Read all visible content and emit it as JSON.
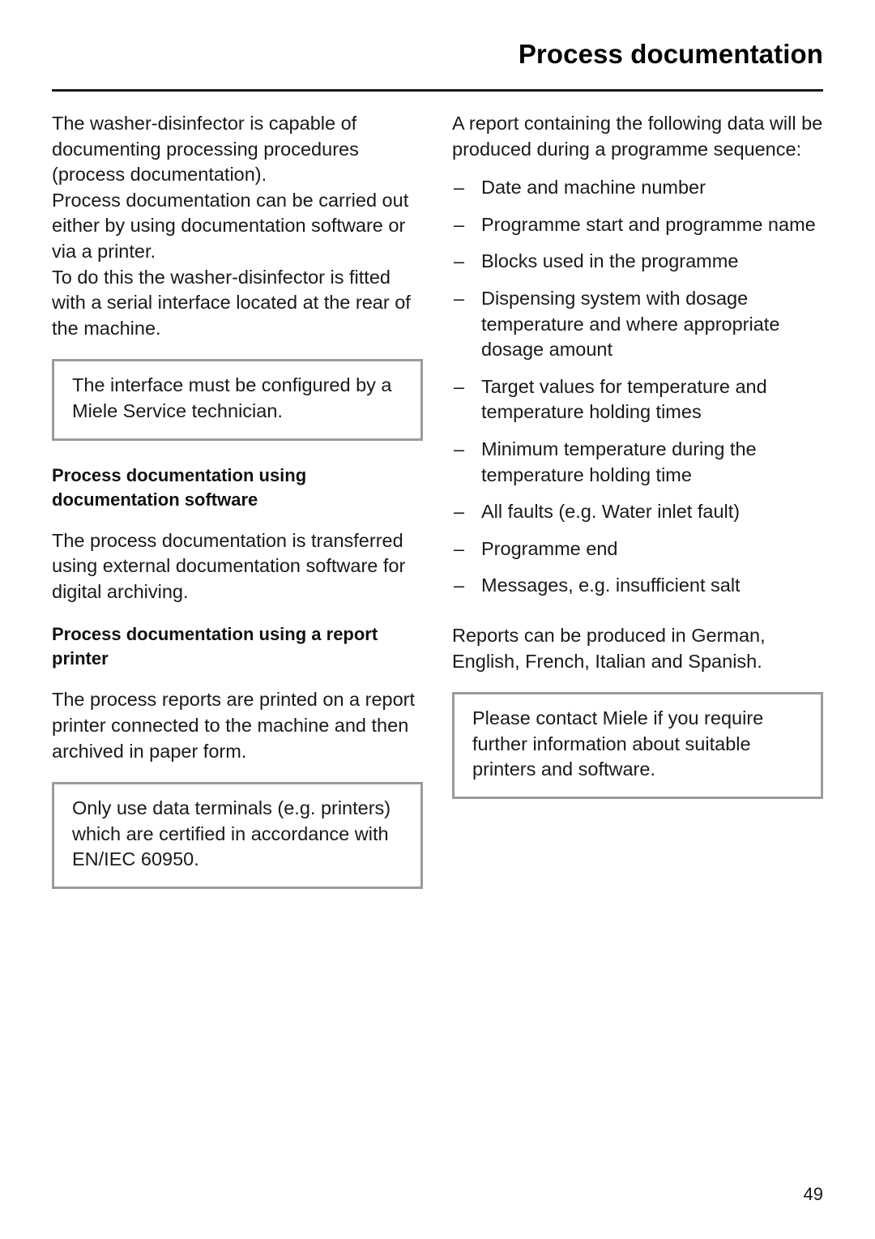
{
  "header": {
    "title": "Process documentation"
  },
  "left_column": {
    "intro_paragraphs": [
      "The washer-disinfector is capable of documenting processing procedures (process documentation).",
      "Process documentation can be carried out either by using documentation software or via a printer.",
      "To do this the washer-disinfector is fitted with a serial interface located at the rear of the machine."
    ],
    "note_1": "The interface must be configured by a Miele Service technician.",
    "subhead_1": "Process documentation using documentation software",
    "para_software": "The process documentation is transferred using external documentation software for digital archiving.",
    "subhead_2": "Process documentation using a report printer",
    "para_printer": "The process reports are printed on a report printer connected to the machine and then archived in paper form.",
    "note_2": "Only use data terminals (e.g. printers) which are certified in accordance with EN/IEC 60950."
  },
  "right_column": {
    "intro": "A report containing the following data will be produced during a programme sequence:",
    "dash": "–",
    "items": [
      "Date and machine number",
      "Programme start and programme name",
      "Blocks used in the programme",
      "Dispensing system with dosage temperature and where appropriate dosage amount",
      "Target values for temperature and temperature holding times",
      "Minimum temperature during the temperature holding time",
      "All faults (e.g. Water inlet fault)",
      "Programme end",
      "Messages, e.g. insufficient salt"
    ],
    "languages_note": "Reports can be produced in German, English, French, Italian and Spanish.",
    "note_3": "Please contact Miele if you require further information about suitable printers and software."
  },
  "footer": {
    "page_number": "49"
  }
}
